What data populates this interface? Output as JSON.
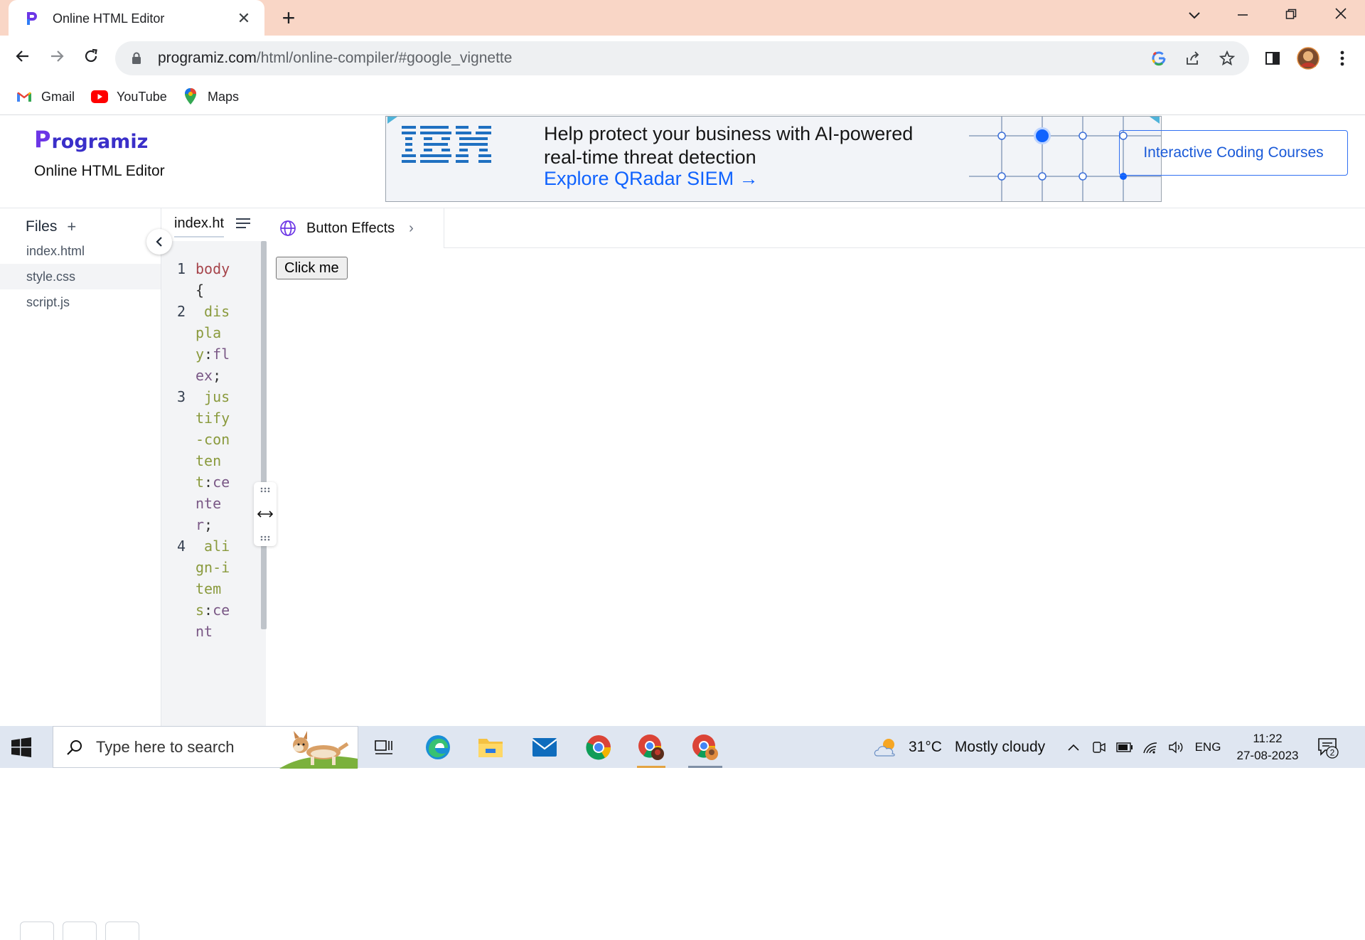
{
  "browser": {
    "tab_title": "Online HTML Editor",
    "url_host": "programiz.com",
    "url_path": "/html/online-compiler/#google_vignette",
    "bookmarks": [
      {
        "label": "Gmail",
        "icon": "gmail-icon"
      },
      {
        "label": "YouTube",
        "icon": "youtube-icon"
      },
      {
        "label": "Maps",
        "icon": "maps-icon"
      }
    ]
  },
  "header": {
    "logo_text": "rogramiz",
    "logo_initial": "P",
    "title": "Online HTML Editor",
    "courses_button": "Interactive Coding Courses"
  },
  "ad": {
    "brand": "IBM",
    "headline": "Help protect your business with AI-powered real-time threat detection",
    "link": "Explore QRadar SIEM →"
  },
  "files": {
    "heading": "Files",
    "add_symbol": "+",
    "items": [
      "index.html",
      "style.css",
      "script.js"
    ],
    "active_index": 1
  },
  "editor": {
    "tab_label": "index.html",
    "lines": [
      {
        "n": "1",
        "tokens": [
          {
            "t": "body",
            "c": "sel"
          },
          {
            "t": "{",
            "c": "pun"
          }
        ]
      },
      {
        "n": "2",
        "tokens": [
          {
            "t": " display",
            "c": "prop"
          },
          {
            "t": ":",
            "c": "pun"
          },
          {
            "t": "flex",
            "c": "val"
          },
          {
            "t": ";",
            "c": "pun"
          }
        ]
      },
      {
        "n": "3",
        "tokens": [
          {
            "t": " justify-content",
            "c": "prop"
          },
          {
            "t": ":",
            "c": "pun"
          },
          {
            "t": "center",
            "c": "val"
          },
          {
            "t": ";",
            "c": "pun"
          }
        ]
      },
      {
        "n": "4",
        "tokens": [
          {
            "t": " align-items",
            "c": "prop"
          },
          {
            "t": ":",
            "c": "pun"
          },
          {
            "t": "cent",
            "c": "val"
          }
        ]
      }
    ]
  },
  "preview": {
    "tab_label": "Button Effects",
    "button_label": "Click me"
  },
  "taskbar": {
    "search_placeholder": "Type here to search",
    "temperature": "31°C",
    "condition": "Mostly cloudy",
    "language": "ENG",
    "time": "11:22",
    "date": "27-08-2023",
    "notification_count": "2"
  },
  "colors": {
    "tabbar": "#f9d6c6",
    "programiz_purple": "#6c36e6",
    "ibm_blue": "#0f62fe",
    "selector": "#a6444b",
    "property": "#8a9a3d",
    "value": "#7a5886"
  }
}
